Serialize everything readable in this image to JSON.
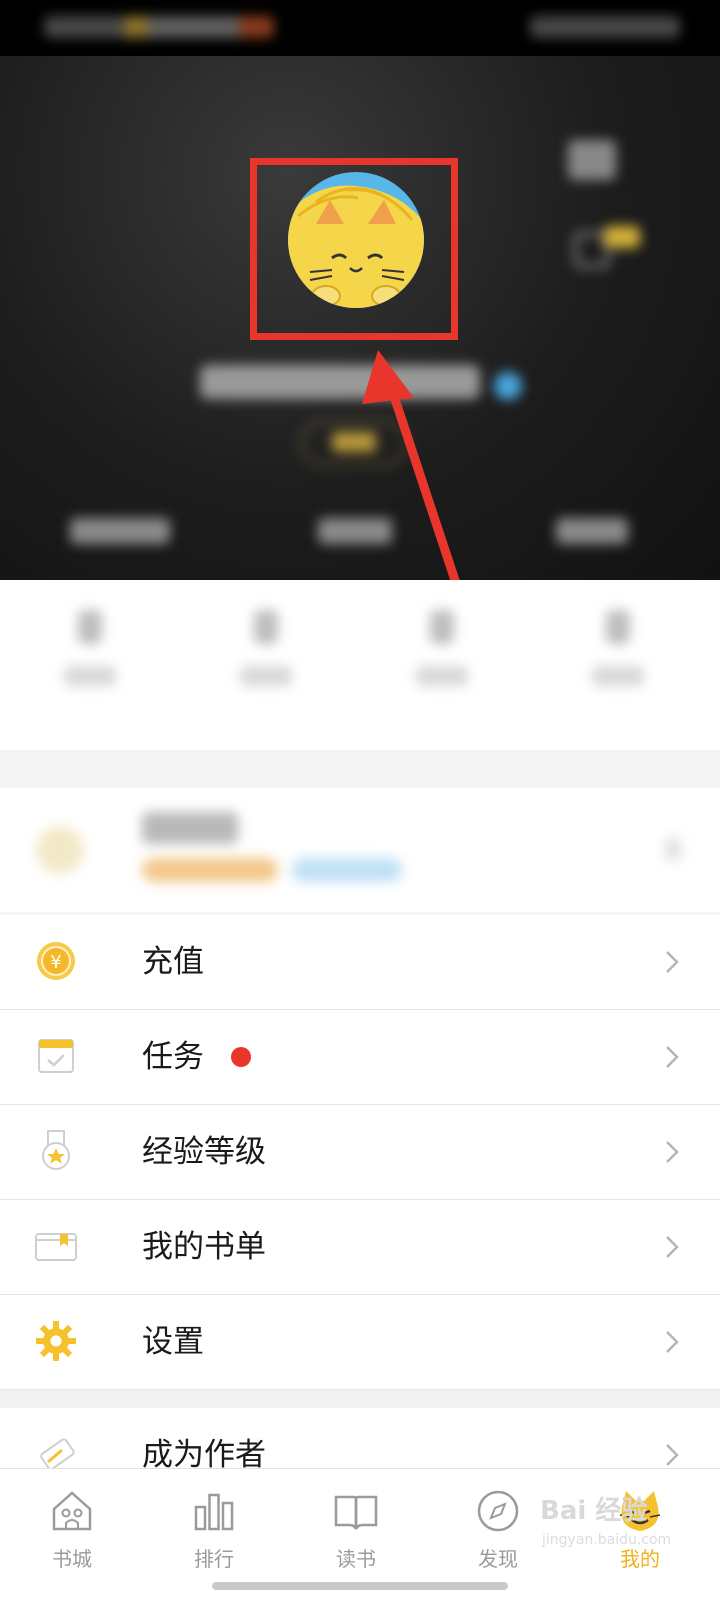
{
  "menu": {
    "items": [
      {
        "label": "充值"
      },
      {
        "label": "任务"
      },
      {
        "label": "经验等级"
      },
      {
        "label": "我的书单"
      },
      {
        "label": "设置"
      },
      {
        "label": "成为作者"
      }
    ]
  },
  "tabbar": {
    "tabs": [
      {
        "label": "书城"
      },
      {
        "label": "排行"
      },
      {
        "label": "读书"
      },
      {
        "label": "发现"
      },
      {
        "label": "我的"
      }
    ]
  },
  "watermark": {
    "text": "Bai 经验",
    "url_text": "jingyan.baidu.com"
  },
  "colors": {
    "accent": "#f0b21a",
    "annotation": "#e8362c"
  }
}
